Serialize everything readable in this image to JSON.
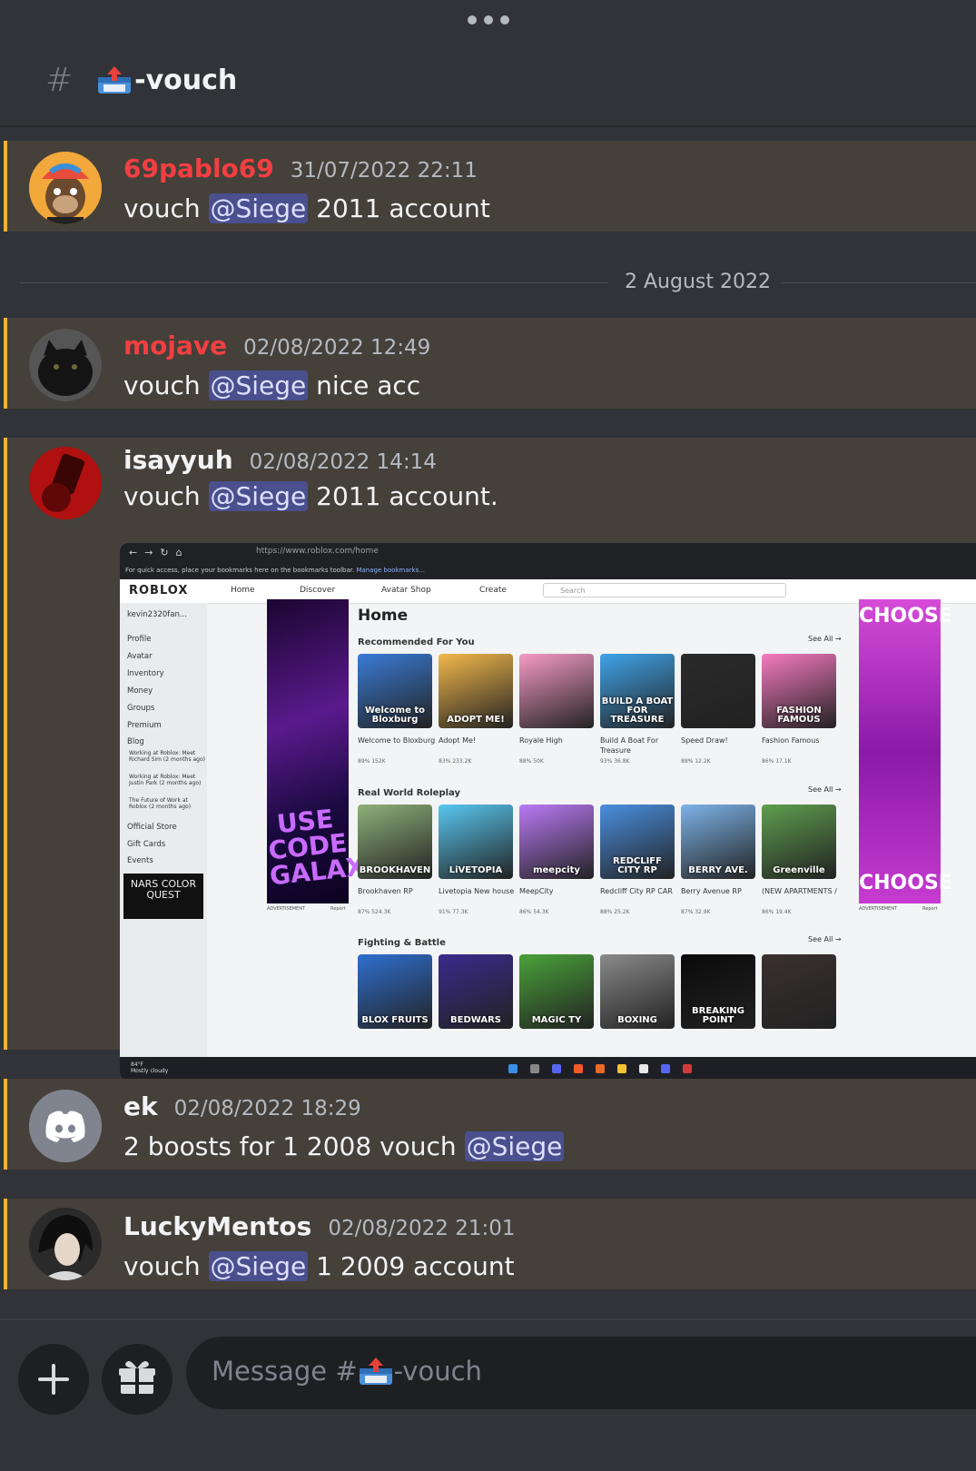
{
  "channel": {
    "name": "-vouch",
    "icon": "inbox-tray-icon"
  },
  "date_divider": "2 August 2022",
  "messages": [
    {
      "username": "69pablo69",
      "timestamp": "31/07/2022 22:11",
      "prefix": "vouch ",
      "mention": "@Siege",
      "suffix": " 2011 account",
      "name_color": "#f23f42"
    },
    {
      "username": "mojave",
      "timestamp": "02/08/2022 12:49",
      "prefix": "vouch ",
      "mention": "@Siege",
      "suffix": " nice acc",
      "name_color": "#f23f42"
    },
    {
      "username": "isayyuh",
      "timestamp": "02/08/2022 14:14",
      "prefix": "vouch ",
      "mention": "@Siege",
      "suffix": " 2011 account.",
      "name_color": "#f2f3f5"
    },
    {
      "username": "ek",
      "timestamp": "02/08/2022 18:29",
      "prefix": "2 boosts for 1 2008 vouch ",
      "mention": "@Siege",
      "suffix": "",
      "name_color": "#f2f3f5"
    },
    {
      "username": "LuckyMentos",
      "timestamp": "02/08/2022 21:01",
      "prefix": "vouch ",
      "mention": "@Siege",
      "suffix": " 1 2009 account",
      "name_color": "#f2f3f5"
    }
  ],
  "screenshot": {
    "url": "https://www.roblox.com/home",
    "bookmarks_text": "For quick access, place your bookmarks here on the bookmarks toolbar.",
    "bookmarks_link": "Manage bookmarks...",
    "logo": "ROBLOX",
    "nav": [
      "Home",
      "Discover",
      "Avatar Shop",
      "Create"
    ],
    "search_placeholder": "Search",
    "user": "kevin2320fan...",
    "sidebar": [
      "Profile",
      "Avatar",
      "Inventory",
      "Money",
      "Groups",
      "Premium",
      "Blog"
    ],
    "blog_posts": [
      "Working at Roblox: Meet Richard Sim (2 months ago)",
      "Working at Roblox: Meet Justin Park (2 months ago)",
      "The Future of Work at Roblox (2 months ago)"
    ],
    "sidebar_bottom": [
      "Official Store",
      "Gift Cards"
    ],
    "events": "Events",
    "nars": "NARS COLOR QUEST",
    "ad_left_text": "USE CODE GALAXY",
    "ad_right_top": "CHOOSE",
    "ad_right_bottom": "CHOOSE",
    "ad_label": "ADVERTISEMENT",
    "report": "Report",
    "home_title": "Home",
    "see_all": "See All →",
    "sections": [
      {
        "title": "Recommended For You",
        "games": [
          {
            "name": "Welcome to Bloxburg",
            "tile": "Welcome to Bloxburg",
            "stats": "89%   152K",
            "color": "#3a7bd5"
          },
          {
            "name": "Adopt Me!",
            "tile": "ADOPT ME!",
            "stats": "83%   233.2K",
            "color": "#f2b84b"
          },
          {
            "name": "Royale High",
            "tile": "",
            "stats": "88%   50K",
            "color": "#f59bc5"
          },
          {
            "name": "Build A Boat For Treasure",
            "tile": "BUILD A BOAT FOR TREASURE",
            "stats": "93%   36.8K",
            "color": "#3fa3e8"
          },
          {
            "name": "Speed Draw!",
            "tile": "",
            "stats": "88%   12.2K",
            "color": "#2a2a2a"
          },
          {
            "name": "Fashion Famous",
            "tile": "FASHION FAMOUS",
            "stats": "86%   17.1K",
            "color": "#f57ac0"
          }
        ]
      },
      {
        "title": "Real World Roleplay",
        "games": [
          {
            "name": "Brookhaven RP",
            "tile": "BROOKHAVEN",
            "stats": "87%   524.3K",
            "color": "#8fb07a"
          },
          {
            "name": "Livetopia New house",
            "tile": "LiVETOPIA",
            "stats": "91%   77.3K",
            "color": "#58c7f0"
          },
          {
            "name": "MeepCity",
            "tile": "meepcity",
            "stats": "86%   54.3K",
            "color": "#b97af5"
          },
          {
            "name": "Redcliff City RP CAR",
            "tile": "REDCLIFF CITY RP",
            "stats": "88%   25.2K",
            "color": "#4a8fe0"
          },
          {
            "name": "Berry Avenue RP",
            "tile": "BERRY AVE.",
            "stats": "87%   32.9K",
            "color": "#7db3e8"
          },
          {
            "name": "(NEW APARTMENTS /",
            "tile": "Greenville",
            "stats": "86%   19.4K",
            "color": "#5f9e4f"
          }
        ]
      },
      {
        "title": "Fighting & Battle",
        "games": [
          {
            "name": "",
            "tile": "BLOX FRUITS",
            "stats": "",
            "color": "#2f6fd0"
          },
          {
            "name": "",
            "tile": "BEDWARS",
            "stats": "",
            "color": "#3a2a8c"
          },
          {
            "name": "",
            "tile": "MAGIC TY",
            "stats": "",
            "color": "#4aa23a"
          },
          {
            "name": "",
            "tile": "BOXING",
            "stats": "",
            "color": "#8a8a8a"
          },
          {
            "name": "",
            "tile": "BREAKING POINT",
            "stats": "",
            "color": "#0a0a0a"
          },
          {
            "name": "",
            "tile": "",
            "stats": "",
            "color": "#3a3030"
          }
        ]
      }
    ],
    "weather_temp": "84°F",
    "weather_desc": "Mostly cloudy"
  },
  "input": {
    "placeholder_prefix": "Message #",
    "placeholder_suffix": "-vouch"
  }
}
